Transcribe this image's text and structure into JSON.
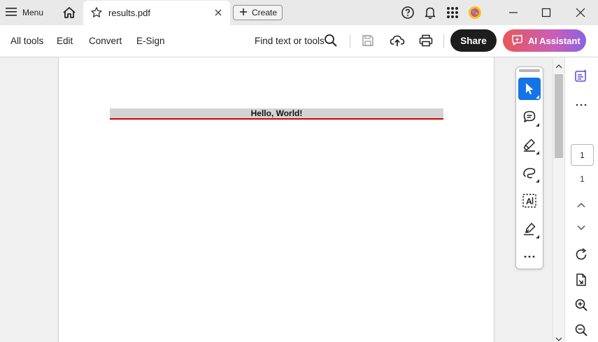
{
  "titlebar": {
    "menu_label": "Menu",
    "tab_title": "results.pdf",
    "create_label": "Create",
    "icons": [
      "menu-icon",
      "home-icon",
      "star-icon",
      "close-icon",
      "plus-icon",
      "help-icon",
      "bell-icon",
      "apps-grid-icon",
      "avatar",
      "minimize-icon",
      "maximize-icon",
      "window-close-icon"
    ]
  },
  "toolbar": {
    "all_tools": "All tools",
    "edit": "Edit",
    "convert": "Convert",
    "esign": "E-Sign",
    "find": "Find text or tools",
    "share": "Share",
    "ai_assistant": "AI Assistant"
  },
  "document": {
    "heading": "Hello, World!"
  },
  "quick_tools": [
    "select-tool",
    "comment-tool",
    "highlight-tool",
    "draw-tool",
    "text-select-tool",
    "sign-tool",
    "more-tools"
  ],
  "right_rail": {
    "current_page": "1",
    "total_pages": "1"
  },
  "colors": {
    "accent": "#1473e6",
    "share_bg": "#1d1d1d",
    "rule_red": "#d40000",
    "ai_gradient": [
      "#e9575a",
      "#8b63e3"
    ]
  }
}
